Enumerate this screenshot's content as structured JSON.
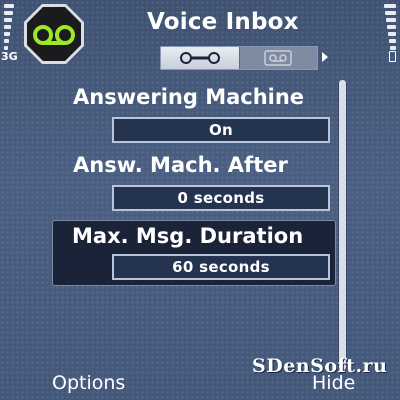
{
  "status": {
    "network": "3G",
    "signal_level": 1.0,
    "battery_level": 1.0
  },
  "header": {
    "title": "Voice Inbox",
    "app_icon": "voicemail-icon",
    "tabs": [
      {
        "icon": "wrench-icon",
        "active": true
      },
      {
        "icon": "voicemail-icon",
        "active": false
      }
    ]
  },
  "settings": [
    {
      "label": "Answering Machine",
      "value": "On",
      "selected": false
    },
    {
      "label": "Answ. Mach. After",
      "value": "0 seconds",
      "selected": false
    },
    {
      "label": "Max. Msg. Duration",
      "value": "60 seconds",
      "selected": true
    }
  ],
  "watermark": "SDenSoft.ru",
  "softkeys": {
    "left": "Options",
    "right": "Hide"
  },
  "colors": {
    "background": "#45597b",
    "selected_item": "#1a2338",
    "icon_green": "#9ee62a"
  }
}
